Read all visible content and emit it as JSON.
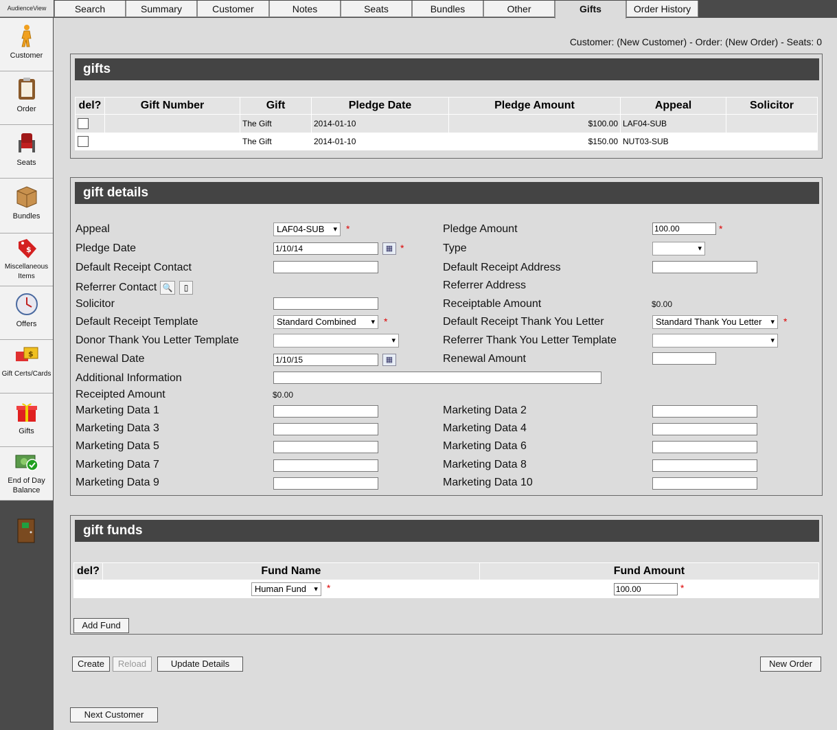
{
  "brand": "AudienceView",
  "sidebar": {
    "items": [
      {
        "label": "Customer",
        "icon": "person-icon"
      },
      {
        "label": "Order",
        "icon": "clipboard-icon"
      },
      {
        "label": "Seats",
        "icon": "seat-icon"
      },
      {
        "label": "Bundles",
        "icon": "box-icon"
      },
      {
        "label": "Miscellaneous Items",
        "icon": "price-tag-icon"
      },
      {
        "label": "Offers",
        "icon": "clock-icon"
      },
      {
        "label": "Gift Certs/Cards",
        "icon": "gift-card-icon"
      },
      {
        "label": "Gifts",
        "icon": "gift-icon"
      },
      {
        "label": "End of Day Balance",
        "icon": "cash-check-icon"
      }
    ],
    "exit_icon": "exit-door-icon"
  },
  "tabs": [
    "Search",
    "Summary",
    "Customer",
    "Notes",
    "Seats",
    "Bundles",
    "Other",
    "Gifts",
    "Order History"
  ],
  "active_tab": "Gifts",
  "status": "Customer: (New Customer) - Order: (New Order) - Seats: 0",
  "gifts": {
    "title": "gifts",
    "columns": [
      "del?",
      "Gift Number",
      "Gift",
      "Pledge Date",
      "Pledge Amount",
      "Appeal",
      "Solicitor"
    ],
    "rows": [
      {
        "gift_number": "",
        "gift": "The Gift",
        "pledge_date": "2014-01-10",
        "pledge_amount": "$100.00",
        "appeal": "LAF04-SUB",
        "solicitor": ""
      },
      {
        "gift_number": "",
        "gift": "The Gift",
        "pledge_date": "2014-01-10",
        "pledge_amount": "$150.00",
        "appeal": "NUT03-SUB",
        "solicitor": ""
      }
    ]
  },
  "details": {
    "title": "gift details",
    "appeal": {
      "label": "Appeal",
      "value": "LAF04-SUB"
    },
    "pledge_date": {
      "label": "Pledge Date",
      "value": "1/10/14"
    },
    "default_receipt_contact": {
      "label": "Default Receipt Contact",
      "value": ""
    },
    "referrer_contact": {
      "label": "Referrer Contact"
    },
    "solicitor": {
      "label": "Solicitor",
      "value": ""
    },
    "default_receipt_template": {
      "label": "Default Receipt Template",
      "value": "Standard Combined"
    },
    "donor_thank_you": {
      "label": "Donor Thank You Letter Template",
      "value": ""
    },
    "renewal_date": {
      "label": "Renewal Date",
      "value": "1/10/15"
    },
    "additional_info": {
      "label": "Additional Information",
      "value": ""
    },
    "receipted_amount": {
      "label": "Receipted Amount",
      "value": "$0.00"
    },
    "pledge_amount": {
      "label": "Pledge Amount",
      "value": "100.00"
    },
    "type": {
      "label": "Type",
      "value": ""
    },
    "default_receipt_address": {
      "label": "Default Receipt Address",
      "value": ""
    },
    "referrer_address": {
      "label": "Referrer Address"
    },
    "receiptable_amount": {
      "label": "Receiptable Amount",
      "value": "$0.00"
    },
    "default_receipt_ty_letter": {
      "label": "Default Receipt Thank You Letter",
      "value": "Standard Thank You Letter"
    },
    "referrer_ty_template": {
      "label": "Referrer Thank You Letter Template",
      "value": ""
    },
    "renewal_amount": {
      "label": "Renewal Amount",
      "value": ""
    },
    "marketing": [
      "Marketing Data 1",
      "Marketing Data 2",
      "Marketing Data 3",
      "Marketing Data 4",
      "Marketing Data 5",
      "Marketing Data 6",
      "Marketing Data 7",
      "Marketing Data 8",
      "Marketing Data 9",
      "Marketing Data 10"
    ]
  },
  "funds": {
    "title": "gift funds",
    "columns": [
      "del?",
      "Fund Name",
      "Fund Amount"
    ],
    "row": {
      "fund_name": "Human Fund",
      "fund_amount": "100.00"
    },
    "add_label": "Add Fund"
  },
  "actions": {
    "create": "Create",
    "reload": "Reload",
    "update_details": "Update Details",
    "new_order": "New Order",
    "next_customer": "Next Customer"
  }
}
